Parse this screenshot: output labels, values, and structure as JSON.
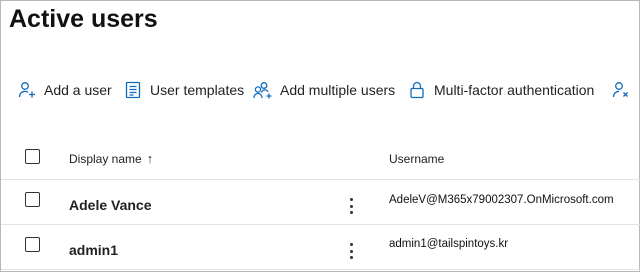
{
  "page": {
    "title": "Active users"
  },
  "toolbar": {
    "items": [
      {
        "label": "Add a user",
        "icon": "add-user-icon"
      },
      {
        "label": "User templates",
        "icon": "template-icon"
      },
      {
        "label": "Add multiple users",
        "icon": "add-multiple-users-icon"
      },
      {
        "label": "Multi-factor authentication",
        "icon": "lock-icon"
      },
      {
        "label": "",
        "icon": "delete-user-icon"
      }
    ],
    "accent_color": "#0f6cbd"
  },
  "table": {
    "columns": {
      "display_name": "Display name",
      "sort_indicator": "↑",
      "username": "Username"
    },
    "rows": [
      {
        "display_name": "Adele Vance",
        "username": "AdeleV@M365x79002307.OnMicrosoft.com"
      },
      {
        "display_name": "admin1",
        "username": "admin1@tailspintoys.kr"
      }
    ]
  }
}
